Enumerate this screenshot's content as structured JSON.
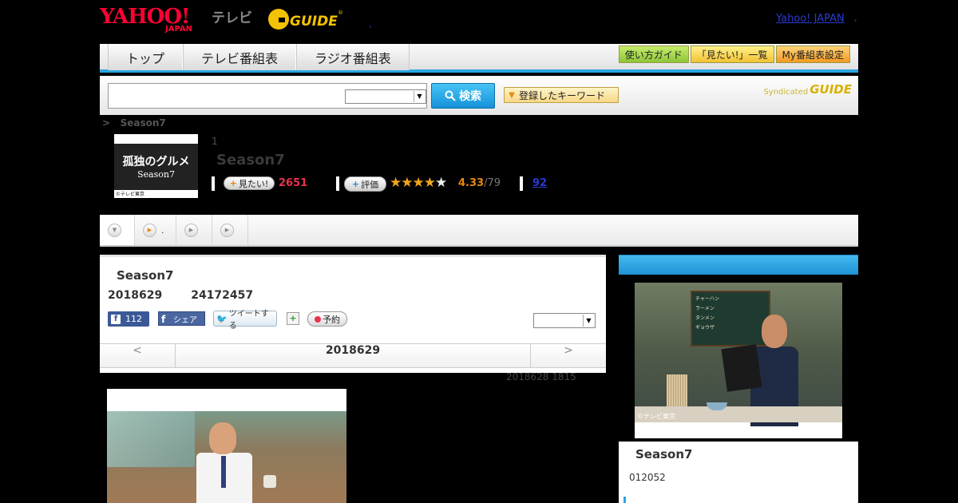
{
  "header": {
    "yahoo_logo": "YAHOO!",
    "japan_logo": "JAPAN",
    "tv_label": "テレビ",
    "gguide_logo": "G-GUIDE",
    "gguide_mark": "®",
    "dot_left": ",",
    "yahoo_japan_link": "Yahoo! JAPAN",
    "dot_right": ","
  },
  "nav": {
    "tabs": [
      {
        "label": "トップ"
      },
      {
        "label": "テレビ番組表"
      },
      {
        "label": "ラジオ番組表"
      }
    ],
    "buttons": [
      {
        "label": "使い方ガイド",
        "color": "#8ec53a"
      },
      {
        "label": "「見たい!」一覧",
        "color": "#f2c233"
      },
      {
        "label": "My番組表設定",
        "color": "#f29a22"
      }
    ],
    "accent": "#2aa6e0"
  },
  "search": {
    "input_value": "",
    "select_value": "",
    "button_label": "検索",
    "keyword_button": "登録したキーワード",
    "syndicated_label": "Syndicated",
    "syndicated_logo": "GUIDE"
  },
  "program": {
    "breadcrumb_sep": ">",
    "breadcrumb_item": "Season7",
    "thumb_title": "孤独のグルメ",
    "thumb_subtitle": "Season7",
    "thumb_copyright": "©テレビ東京",
    "episode_number": "1",
    "title": "Season7",
    "mitai_label": "見たい!",
    "mitai_count": "2651",
    "hyoka_label": "評価",
    "rating_value": "4.33",
    "rating_count": "/79",
    "rating_stars": 4.33,
    "review_link": "92"
  },
  "subtabs": [
    {
      "label": "",
      "icon": "chevron-down-icon"
    },
    {
      "label": ".",
      "icon": "play-icon"
    },
    {
      "label": "",
      "icon": "play-icon"
    },
    {
      "label": "",
      "icon": "play-icon"
    }
  ],
  "episode": {
    "title": "Season7",
    "date": "2018629",
    "time": "24172457",
    "fb_like_count": "112",
    "fb_share": "シェア",
    "tweet": "ツイートする",
    "reserve": "予約",
    "select_value": "",
    "prev": "<",
    "nav_date": "2018629",
    "next": ">",
    "update_note": "2018628  1815"
  },
  "side": {
    "header": "",
    "copyright": "©テレビ東京",
    "title": "Season7",
    "meta": "012052",
    "board_lines": [
      "チャーハン",
      "ラーメン",
      "タンメン",
      "ギョウザ"
    ]
  }
}
